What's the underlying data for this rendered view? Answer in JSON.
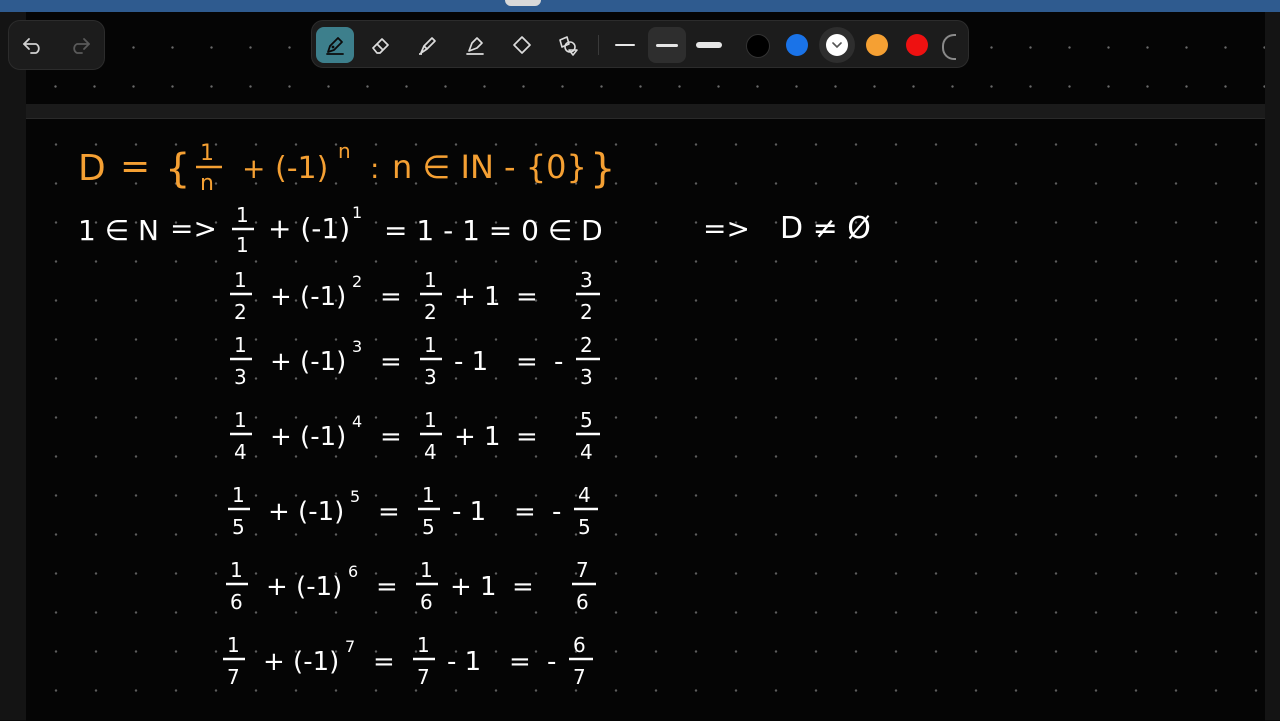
{
  "toolbar": {
    "tools": [
      "pen-icon",
      "eraser-icon",
      "highlighter-icon",
      "marker-icon",
      "lasso-icon",
      "shapes-icon"
    ],
    "active_tool": "pen",
    "stroke_widths": [
      "thin",
      "medium",
      "thick"
    ],
    "active_stroke": "medium",
    "colors": [
      "#000000",
      "#1a73e8",
      "#ffffff",
      "#f5a033",
      "#ee1111"
    ],
    "selected_color": "#ffffff"
  },
  "notes": {
    "set_def": {
      "D": "D",
      "eq": "=",
      "lbrace": "{",
      "num": "1",
      "den": "n",
      "plus": "+",
      "base": "(-1)",
      "exp": "n",
      "colon": ":",
      "cond": "n ∈ IN - {0}",
      "rbrace": "}"
    },
    "row1": {
      "premise": "1 ∈ N",
      "implies": "=>",
      "num": "1",
      "den": "1",
      "term": "+ (-1)",
      "exp": "1",
      "rhs": "=   1 - 1   = 0  ∈ D",
      "implies2": "=>",
      "concl": "D ≠ Ø"
    },
    "rows": [
      {
        "num": "1",
        "den": "2",
        "term": "+ (-1)",
        "exp": "2",
        "eq": "=",
        "mid_num": "1",
        "mid_den": "2",
        "op": "+ 1",
        "eq2": "=",
        "res_sign": "",
        "res_num": "3",
        "res_den": "2"
      },
      {
        "num": "1",
        "den": "3",
        "term": "+ (-1)",
        "exp": "3",
        "eq": "=",
        "mid_num": "1",
        "mid_den": "3",
        "op": "- 1",
        "eq2": "=",
        "res_sign": "-",
        "res_num": "2",
        "res_den": "3"
      },
      {
        "num": "1",
        "den": "4",
        "term": "+ (-1)",
        "exp": "4",
        "eq": "=",
        "mid_num": "1",
        "mid_den": "4",
        "op": "+ 1",
        "eq2": "=",
        "res_sign": "",
        "res_num": "5",
        "res_den": "4"
      },
      {
        "num": "1",
        "den": "5",
        "term": "+ (-1)",
        "exp": "5",
        "eq": "=",
        "mid_num": "1",
        "mid_den": "5",
        "op": "- 1",
        "eq2": "=",
        "res_sign": "-",
        "res_num": "4",
        "res_den": "5"
      },
      {
        "num": "1",
        "den": "6",
        "term": "+ (-1)",
        "exp": "6",
        "eq": "=",
        "mid_num": "1",
        "mid_den": "6",
        "op": "+ 1",
        "eq2": "=",
        "res_sign": "",
        "res_num": "7",
        "res_den": "6"
      },
      {
        "num": "1",
        "den": "7",
        "term": "+ (-1)",
        "exp": "7",
        "eq": "=",
        "mid_num": "1",
        "mid_den": "7",
        "op": "- 1",
        "eq2": "=",
        "res_sign": "-",
        "res_num": "6",
        "res_den": "7"
      }
    ]
  }
}
